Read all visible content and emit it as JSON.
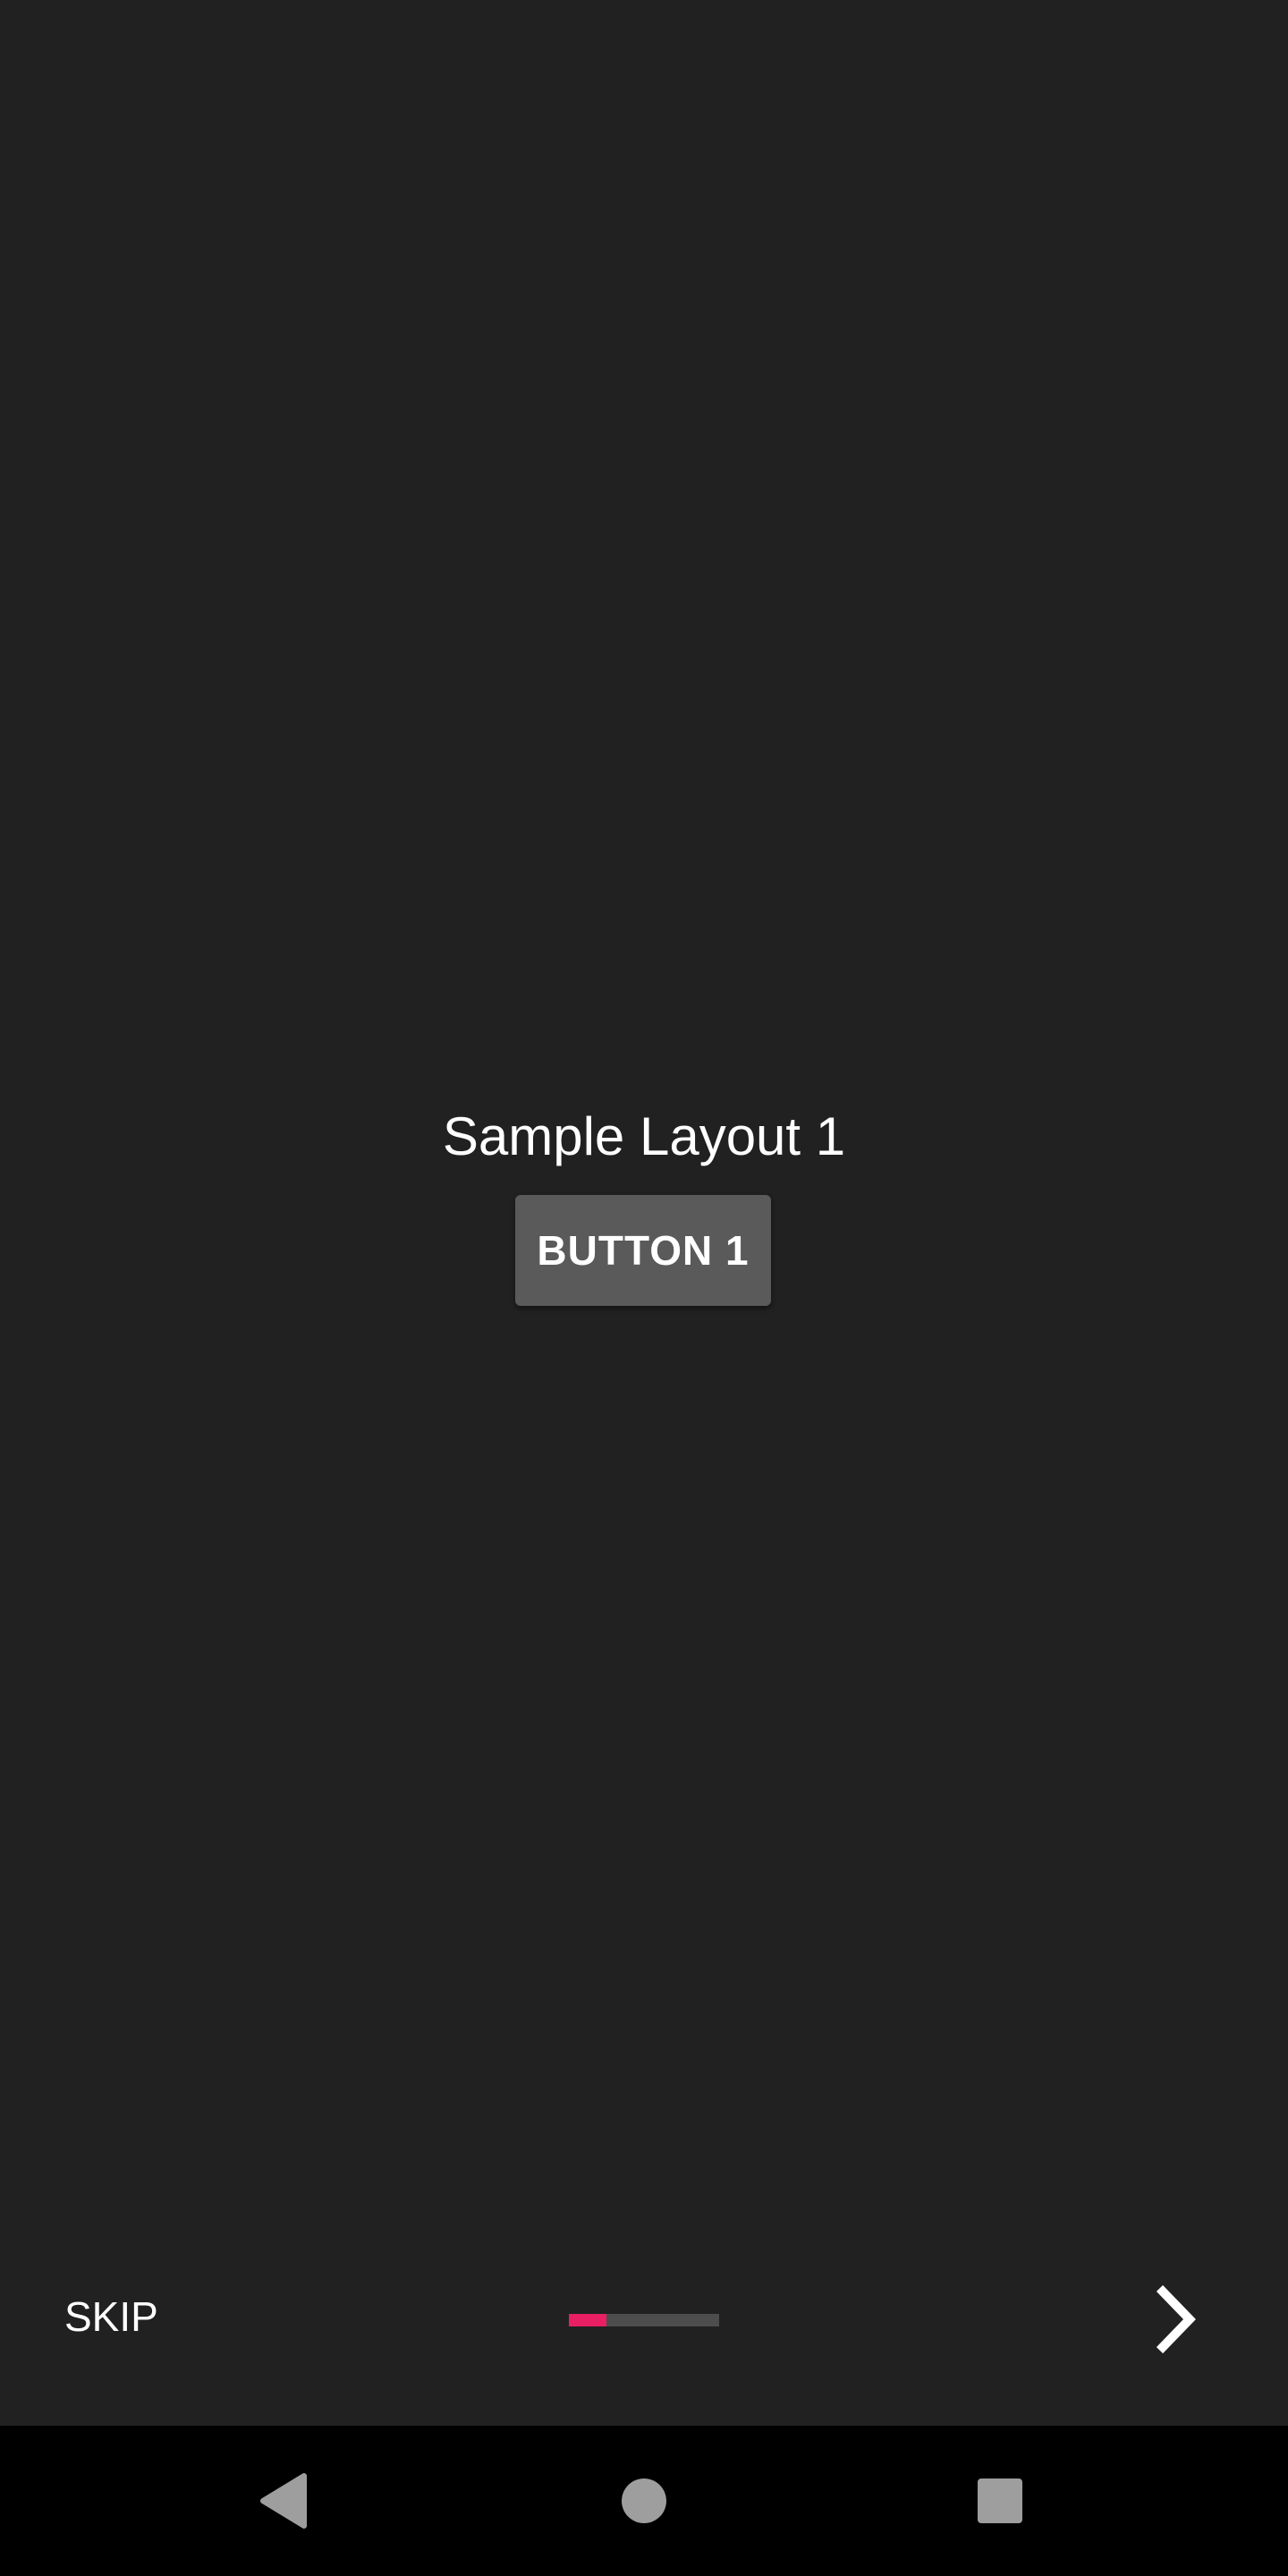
{
  "content": {
    "title": "Sample Layout 1",
    "button_label": "BUTTON 1"
  },
  "onboarding": {
    "skip_label": "SKIP",
    "progress_fraction": 0.25,
    "progress_color": "#e91e63",
    "next_icon": "chevron-right-icon"
  },
  "navbar": {
    "back_icon": "back-triangle-icon",
    "home_icon": "home-circle-icon",
    "recents_icon": "recents-square-icon"
  }
}
